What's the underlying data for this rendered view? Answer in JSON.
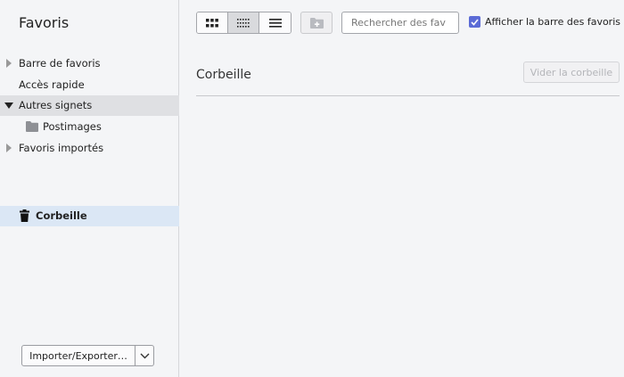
{
  "sidebar": {
    "title": "Favoris",
    "items": [
      {
        "label": "Barre de favoris",
        "icon": "triangle-right-icon"
      },
      {
        "label": "Accès rapide"
      },
      {
        "label": "Autres signets",
        "icon": "triangle-down-icon"
      },
      {
        "label": "Postimages",
        "icon": "folder-icon"
      },
      {
        "label": "Favoris importés",
        "icon": "triangle-right-icon"
      },
      {
        "label": "Corbeille",
        "icon": "trash-icon"
      }
    ],
    "import_label": "Importer/Exporter…"
  },
  "toolbar": {
    "view_modes": [
      "grid-large-icon",
      "grid-small-icon",
      "list-icon"
    ],
    "active_view": "grid-small-icon",
    "search_placeholder": "Rechercher des fav",
    "show_bar_label": "Afficher la barre des favoris",
    "show_bar_checked": true
  },
  "content": {
    "folder_title": "Corbeille",
    "empty_button": "Vider la corbeille"
  },
  "colors": {
    "accent": "#5b6bd6",
    "selected_row": "#dfe0e3",
    "trash_row": "#dbe7f5"
  }
}
